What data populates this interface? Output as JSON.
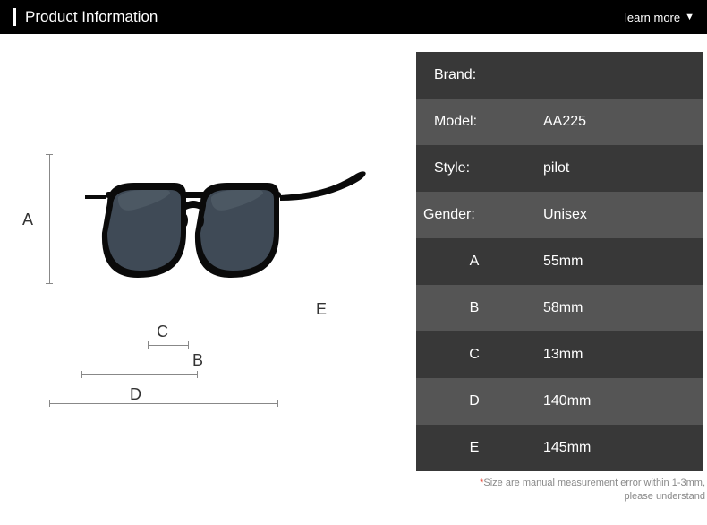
{
  "header": {
    "title": "Product Information",
    "learn_more": "learn more"
  },
  "diagram": {
    "labelA": "A",
    "labelB": "B",
    "labelC": "C",
    "labelD": "D",
    "labelE": "E"
  },
  "specs": [
    {
      "label": "Brand:",
      "value": "",
      "labelAlign": "left"
    },
    {
      "label": "Model:",
      "value": "AA225",
      "labelAlign": "left"
    },
    {
      "label": "Style:",
      "value": "pilot",
      "labelAlign": "left"
    },
    {
      "label": "Gender:",
      "value": "Unisex",
      "labelAlign": "left-tight"
    },
    {
      "label": "A",
      "value": "55mm",
      "labelAlign": "center"
    },
    {
      "label": "B",
      "value": "58mm",
      "labelAlign": "center"
    },
    {
      "label": "C",
      "value": "13mm",
      "labelAlign": "center"
    },
    {
      "label": "D",
      "value": "140mm",
      "labelAlign": "center"
    },
    {
      "label": "E",
      "value": "145mm",
      "labelAlign": "center"
    }
  ],
  "disclaimer": {
    "line1": "Size are manual measurement error within 1-3mm,",
    "line2": "please understand"
  }
}
